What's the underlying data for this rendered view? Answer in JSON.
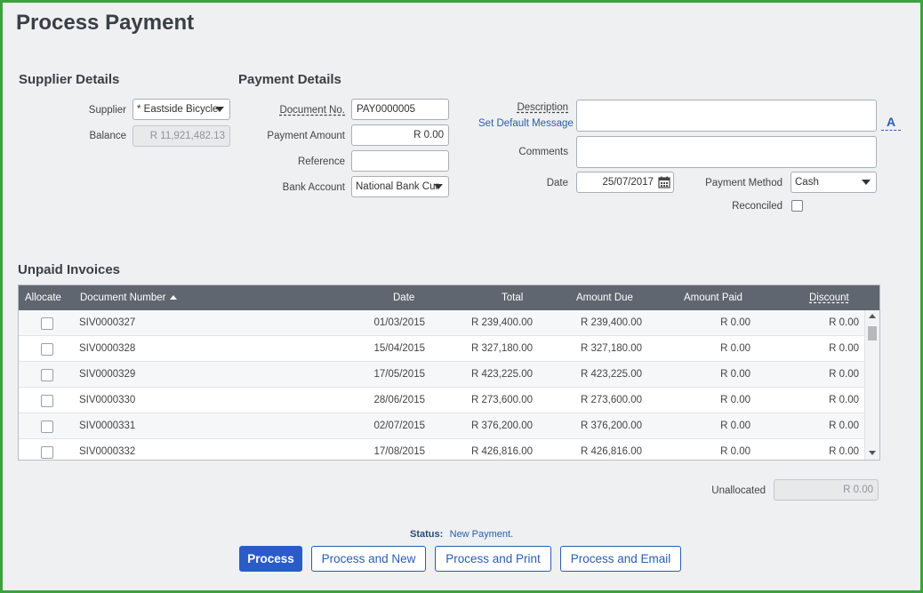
{
  "page_title": "Process Payment",
  "supplier": {
    "section_title": "Supplier Details",
    "supplier_label": "Supplier",
    "supplier_value": "* Eastside Bicycle",
    "balance_label": "Balance",
    "balance_value": "R 11,921,482.13"
  },
  "payment": {
    "section_title": "Payment Details",
    "doc_no_label": "Document No.",
    "doc_no_value": "PAY0000005",
    "amount_label": "Payment Amount",
    "amount_value": "R 0.00",
    "reference_label": "Reference",
    "reference_value": "",
    "bank_label": "Bank Account",
    "bank_value": "National Bank Cur"
  },
  "extra": {
    "description_label": "Description",
    "set_default_link": "Set Default Message",
    "a_button": "A",
    "comments_label": "Comments",
    "date_label": "Date",
    "date_value": "25/07/2017",
    "method_label": "Payment Method",
    "method_value": "Cash",
    "reconciled_label": "Reconciled"
  },
  "invoices": {
    "section_title": "Unpaid Invoices",
    "columns": [
      "Allocate",
      "Document Number",
      "Date",
      "Total",
      "Amount Due",
      "Amount Paid",
      "Discount"
    ],
    "rows": [
      [
        "SIV0000327",
        "01/03/2015",
        "R 239,400.00",
        "R 239,400.00",
        "R 0.00",
        "R 0.00"
      ],
      [
        "SIV0000328",
        "15/04/2015",
        "R 327,180.00",
        "R 327,180.00",
        "R 0.00",
        "R 0.00"
      ],
      [
        "SIV0000329",
        "17/05/2015",
        "R 423,225.00",
        "R 423,225.00",
        "R 0.00",
        "R 0.00"
      ],
      [
        "SIV0000330",
        "28/06/2015",
        "R 273,600.00",
        "R 273,600.00",
        "R 0.00",
        "R 0.00"
      ],
      [
        "SIV0000331",
        "02/07/2015",
        "R 376,200.00",
        "R 376,200.00",
        "R 0.00",
        "R 0.00"
      ],
      [
        "SIV0000332",
        "17/08/2015",
        "R 426,816.00",
        "R 426,816.00",
        "R 0.00",
        "R 0.00"
      ]
    ]
  },
  "unallocated": {
    "label": "Unallocated",
    "value": "R 0.00"
  },
  "status": {
    "label": "Status:",
    "value": "New Payment."
  },
  "buttons": {
    "process": "Process",
    "process_new": "Process and New",
    "process_print": "Process and Print",
    "process_email": "Process and Email"
  }
}
